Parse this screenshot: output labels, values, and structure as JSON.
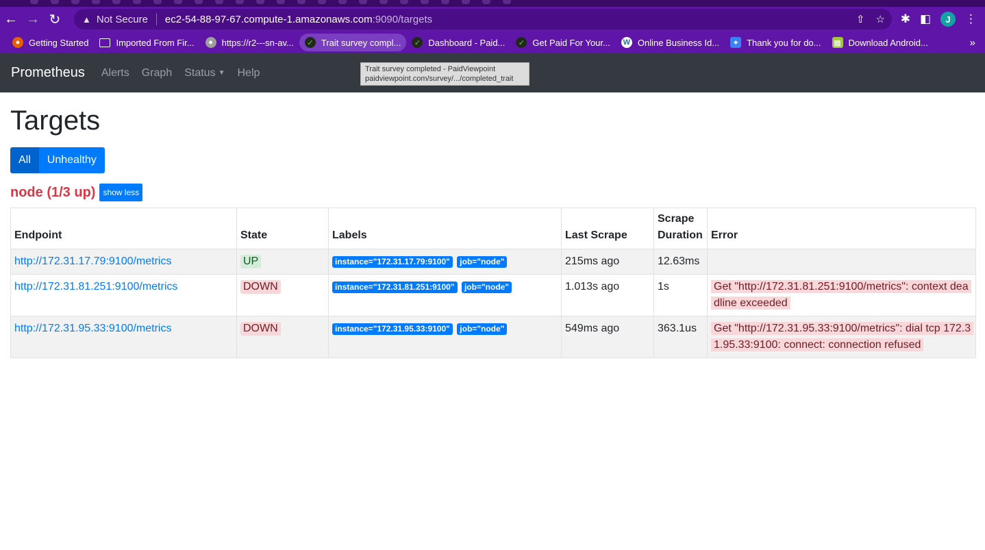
{
  "browser": {
    "omnibox": {
      "security_label": "Not Secure",
      "host": "ec2-54-88-97-67.compute-1.amazonaws.com",
      "path": ":9090/targets"
    },
    "profile_initial": "J",
    "bookmarks": [
      {
        "label": "Getting Started",
        "icon": "firefox-icon",
        "color": "#e66000"
      },
      {
        "label": "Imported From Fir...",
        "icon": "folder-icon",
        "color": "#ffffff"
      },
      {
        "label": "https://r2---sn-av...",
        "icon": "globe-icon",
        "color": "#9e9e9e"
      },
      {
        "label": "Trait survey compl...",
        "icon": "check-icon",
        "color": "#7cc242"
      },
      {
        "label": "Dashboard - Paid...",
        "icon": "check-icon",
        "color": "#7cc242"
      },
      {
        "label": "Get Paid For Your...",
        "icon": "check-icon",
        "color": "#7cc242"
      },
      {
        "label": "Online Business Id...",
        "icon": "wordpress-icon",
        "color": "#21759b"
      },
      {
        "label": "Thank you for do...",
        "icon": "butterfly-icon",
        "color": "#3b82f6"
      },
      {
        "label": "Download Android...",
        "icon": "android-icon",
        "color": "#a4c639"
      }
    ],
    "tooltip": {
      "title": "Trait survey completed - PaidViewpoint",
      "url": "paidviewpoint.com/survey/.../completed_trait"
    }
  },
  "navbar": {
    "brand": "Prometheus",
    "links": [
      "Alerts",
      "Graph",
      "Status",
      "Help"
    ]
  },
  "page": {
    "title": "Targets",
    "filters": {
      "all": "All",
      "unhealthy": "Unhealthy",
      "active": "All"
    },
    "pool": {
      "title": "node (1/3 up)",
      "toggle_label": "show less",
      "columns": [
        "Endpoint",
        "State",
        "Labels",
        "Last Scrape",
        "Scrape Duration",
        "Error"
      ],
      "rows": [
        {
          "endpoint": "http://172.31.17.79:9100/metrics",
          "state": "UP",
          "labels": [
            "instance=\"172.31.17.79:9100\"",
            "job=\"node\""
          ],
          "last_scrape": "215ms ago",
          "duration": "12.63ms",
          "error": ""
        },
        {
          "endpoint": "http://172.31.81.251:9100/metrics",
          "state": "DOWN",
          "labels": [
            "instance=\"172.31.81.251:9100\"",
            "job=\"node\""
          ],
          "last_scrape": "1.013s ago",
          "duration": "1s",
          "error": "Get \"http://172.31.81.251:9100/metrics\": context deadline exceeded"
        },
        {
          "endpoint": "http://172.31.95.33:9100/metrics",
          "state": "DOWN",
          "labels": [
            "instance=\"172.31.95.33:9100\"",
            "job=\"node\""
          ],
          "last_scrape": "549ms ago",
          "duration": "363.1us",
          "error": "Get \"http://172.31.95.33:9100/metrics\": dial tcp 172.31.95.33:9100: connect: connection refused"
        }
      ]
    }
  }
}
